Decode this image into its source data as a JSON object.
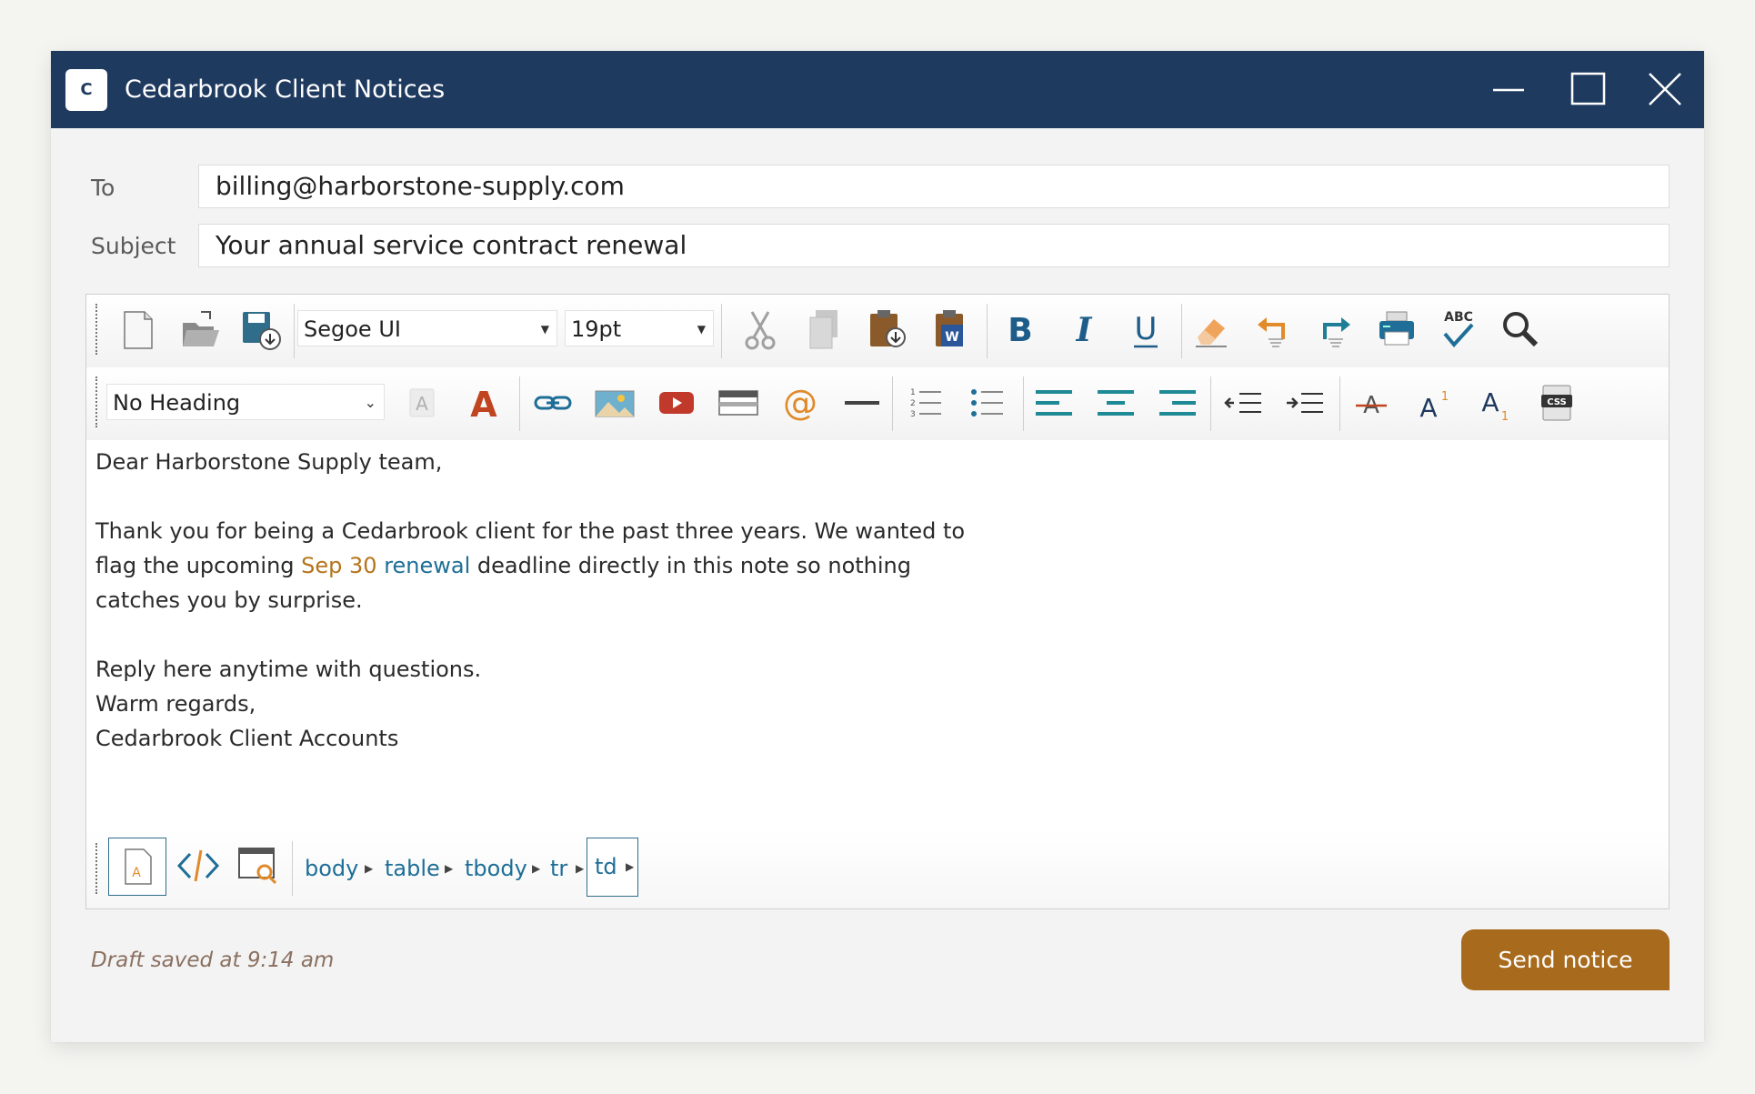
{
  "window": {
    "title": "Cedarbrook Client Notices",
    "logo_letter": "C"
  },
  "fields": {
    "to_label": "To",
    "to_value": "billing@harborstone-supply.com",
    "subject_label": "Subject",
    "subject_value": "Your annual service contract renewal"
  },
  "toolbar": {
    "font_family": "Segoe UI",
    "font_size": "19pt",
    "heading": "No Heading",
    "row1_icons": [
      "new-document-icon",
      "open-folder-icon",
      "save-icon",
      "cut-icon",
      "copy-icon",
      "paste-icon",
      "paste-from-word-icon",
      "bold-icon",
      "italic-icon",
      "underline-icon",
      "eraser-icon",
      "undo-icon",
      "redo-icon",
      "print-icon",
      "spellcheck-icon",
      "find-icon"
    ],
    "row2_icons": [
      "highlight-color-icon",
      "font-color-icon",
      "link-icon",
      "image-icon",
      "video-icon",
      "table-icon",
      "email-link-icon",
      "horizontal-rule-icon",
      "ordered-list-icon",
      "unordered-list-icon",
      "align-left-icon",
      "align-center-icon",
      "align-right-icon",
      "outdent-icon",
      "indent-icon",
      "strikethrough-icon",
      "superscript-icon",
      "subscript-icon",
      "css-icon"
    ]
  },
  "body": {
    "greeting": "Dear Harborstone Supply team,",
    "p1_line1": "Thank you for being a Cedarbrook client for the past three years. We wanted to",
    "p1_line2_a": "flag the upcoming ",
    "p1_date": "Sep 30",
    "p1_link": "renewal",
    "p1_line2_b": " deadline directly in this note so nothing",
    "p1_line3": "catches you by surprise.",
    "p2_line1": "Reply here anytime with questions.",
    "p2_line2": "Warm regards,",
    "p2_line3": "Cedarbrook Client Accounts"
  },
  "status_bar": {
    "path": [
      "body",
      "table",
      "tbody",
      "tr",
      "td"
    ]
  },
  "footer": {
    "draft_status": "Draft saved at 9:14 am",
    "send_label": "Send notice"
  },
  "colors": {
    "titlebar": "#1f3a5f",
    "accent": "#a86a1c",
    "link": "#1e6e97"
  }
}
